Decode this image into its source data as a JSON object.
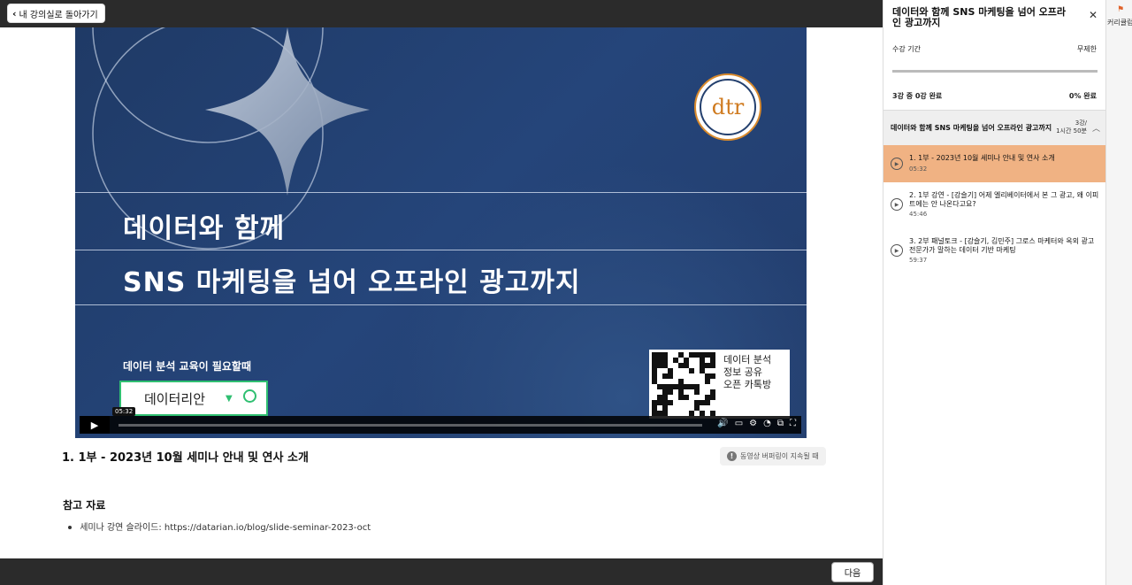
{
  "header": {
    "back_label": "내 강의실로 돌아가기"
  },
  "slide": {
    "title_line1": "데이터와 함께",
    "title_line2": "SNS 마케팅을 넘어 오프라인 광고까지",
    "logo_text": "dtr",
    "edu_text": "데이터 분석 교육이 필요할때",
    "search_text": "데이터리안",
    "qr_text_line1": "데이터 분석",
    "qr_text_line2": "정보 공유",
    "qr_text_line3": "오픈 카톡방"
  },
  "player": {
    "time_tooltip": "05:32"
  },
  "lecture": {
    "title": "1. 1부 - 2023년 10월 세미나 안내 및 연사 소개",
    "buffer_label": "동영상 버퍼링이 지속될 때",
    "ref_title": "참고 자료",
    "ref_item_label": "세미나 강연 슬라이드: ",
    "ref_item_url": "https://datarian.io/blog/slide-seminar-2023-oct"
  },
  "footer": {
    "next_label": "다음"
  },
  "sidebar": {
    "course_title": "데이터와 함께 SNS 마케팅을 넘어 오프라인 광고까지",
    "period_label": "수강 기간",
    "period_value": "무제한",
    "progress_fraction": 0,
    "done_label": "3강 중 0강 완료",
    "done_pct": "0% 완료",
    "section": {
      "title": "데이터와 함께 SNS 마케팅을 넘어 오프라인 광고까지",
      "count": "3강/",
      "duration": "1시간 50분"
    },
    "lessons": [
      {
        "title": "1. 1부 - 2023년 10월 세미나 안내 및 연사 소개",
        "duration": "05:32",
        "active": true
      },
      {
        "title": "2. 1부 강연 - [강슬기] 어제 엘리베이터에서 본 그 광고, 왜 이피트에는 안 나온다고요?",
        "duration": "45:46",
        "active": false
      },
      {
        "title": "3. 2부 패널토크 - [강슬기, 김민주] 그로스 마케터와 옥외 광고 전문가가 말하는 데이터 기반 마케팅",
        "duration": "59:37",
        "active": false
      }
    ]
  },
  "rail": {
    "label": "커리큘럼"
  },
  "colors": {
    "accent": "#f0b283",
    "slide_bg": "#24406e",
    "green": "#2fbf71",
    "logo_orange": "#d98a2c"
  }
}
